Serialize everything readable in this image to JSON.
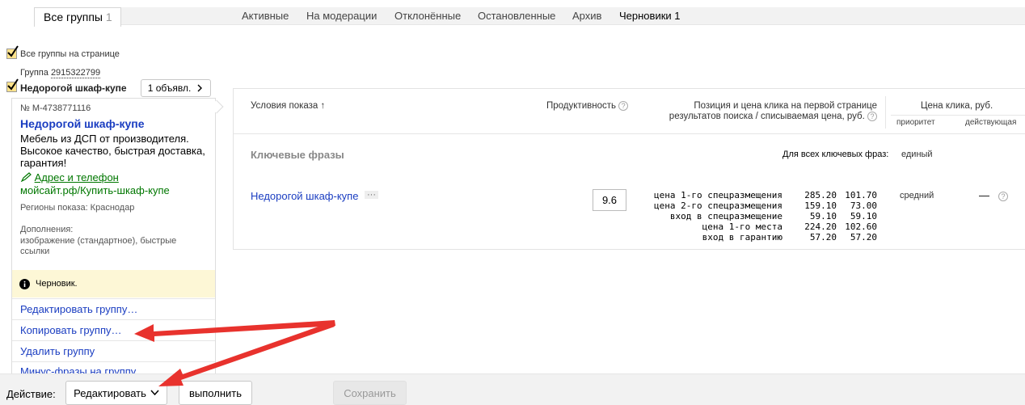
{
  "tabs": {
    "active_label": "Все группы",
    "active_count": "1",
    "items": [
      {
        "label": "Активные"
      },
      {
        "label": "На модерации"
      },
      {
        "label": "Отклонённые"
      },
      {
        "label": "Остановленные"
      },
      {
        "label": "Архив"
      },
      {
        "label": "Черновики 1"
      }
    ]
  },
  "select_all_label": "Все группы на странице",
  "group": {
    "label": "Группа",
    "id": "2915322799",
    "name": "Недорогой шкаф-купе",
    "ads_button": "1 объявл.",
    "chevron_icon": "chevron-right-icon"
  },
  "ad": {
    "number": "№ M-4738771116",
    "title": "Недорогой шкаф-купе",
    "text_lines": [
      "Мебель из ДСП от производителя.",
      "Высокое качество, быстрая доставка,",
      "гарантия!"
    ],
    "contact_link": "Адрес и телефон",
    "url": "мойсайт.рф/Купить-шкаф-купе",
    "regions": "Регионы показа: Краснодар",
    "extras_label": "Дополнения:",
    "extras_lines": [
      "изображение (стандартное), быстрые",
      "ссылки"
    ],
    "status": "Черновик.",
    "status_icon": "info-icon"
  },
  "actions": {
    "edit_group": "Редактировать группу…",
    "copy_group": "Копировать группу…",
    "delete_group": "Удалить группу",
    "minus_phrases": "Минус-фразы на группу"
  },
  "table": {
    "col_conditions": "Условия показа",
    "sort_icon": "arrow-up-icon",
    "col_productivity": "Продуктивность",
    "col_position_l1": "Позиция и цена клика на первой странице",
    "col_position_l2": "результатов поиска / списываемая цена, руб.",
    "col_price": "Цена клика, руб.",
    "col_priority": "приоритет",
    "col_effective": "действующая",
    "section_label": "Ключевые фразы",
    "all_phrases_label": "Для всех ключевых фраз:",
    "all_phrases_value": "единый",
    "keyword": "Недорогой шкаф-купе",
    "more_icon": "ellipsis-icon",
    "productivity_value": "9.6",
    "bids": [
      {
        "label": "цена 1-го спецразмещения",
        "price": "285.20",
        "charged": "101.70"
      },
      {
        "label": "цена 2-го спецразмещения",
        "price": "159.10",
        "charged": "73.00"
      },
      {
        "label": "вход в спецразмещение",
        "price": "59.10",
        "charged": "59.10"
      },
      {
        "label": "цена 1-го места",
        "price": "224.20",
        "charged": "102.60"
      },
      {
        "label": "вход в гарантию",
        "price": "57.20",
        "charged": "57.20"
      }
    ],
    "priority_value": "средний",
    "effective_value": "—"
  },
  "bottom": {
    "action_label": "Действие:",
    "select_value": "Редактировать",
    "execute_button": "выполнить",
    "save_button": "Сохранить"
  },
  "colors": {
    "link": "#1a3dc1",
    "green_link": "#007700",
    "checkbox": "#ffe38b",
    "draft_bg": "#fdf7d6",
    "annotation_arrow": "#e8322d"
  }
}
